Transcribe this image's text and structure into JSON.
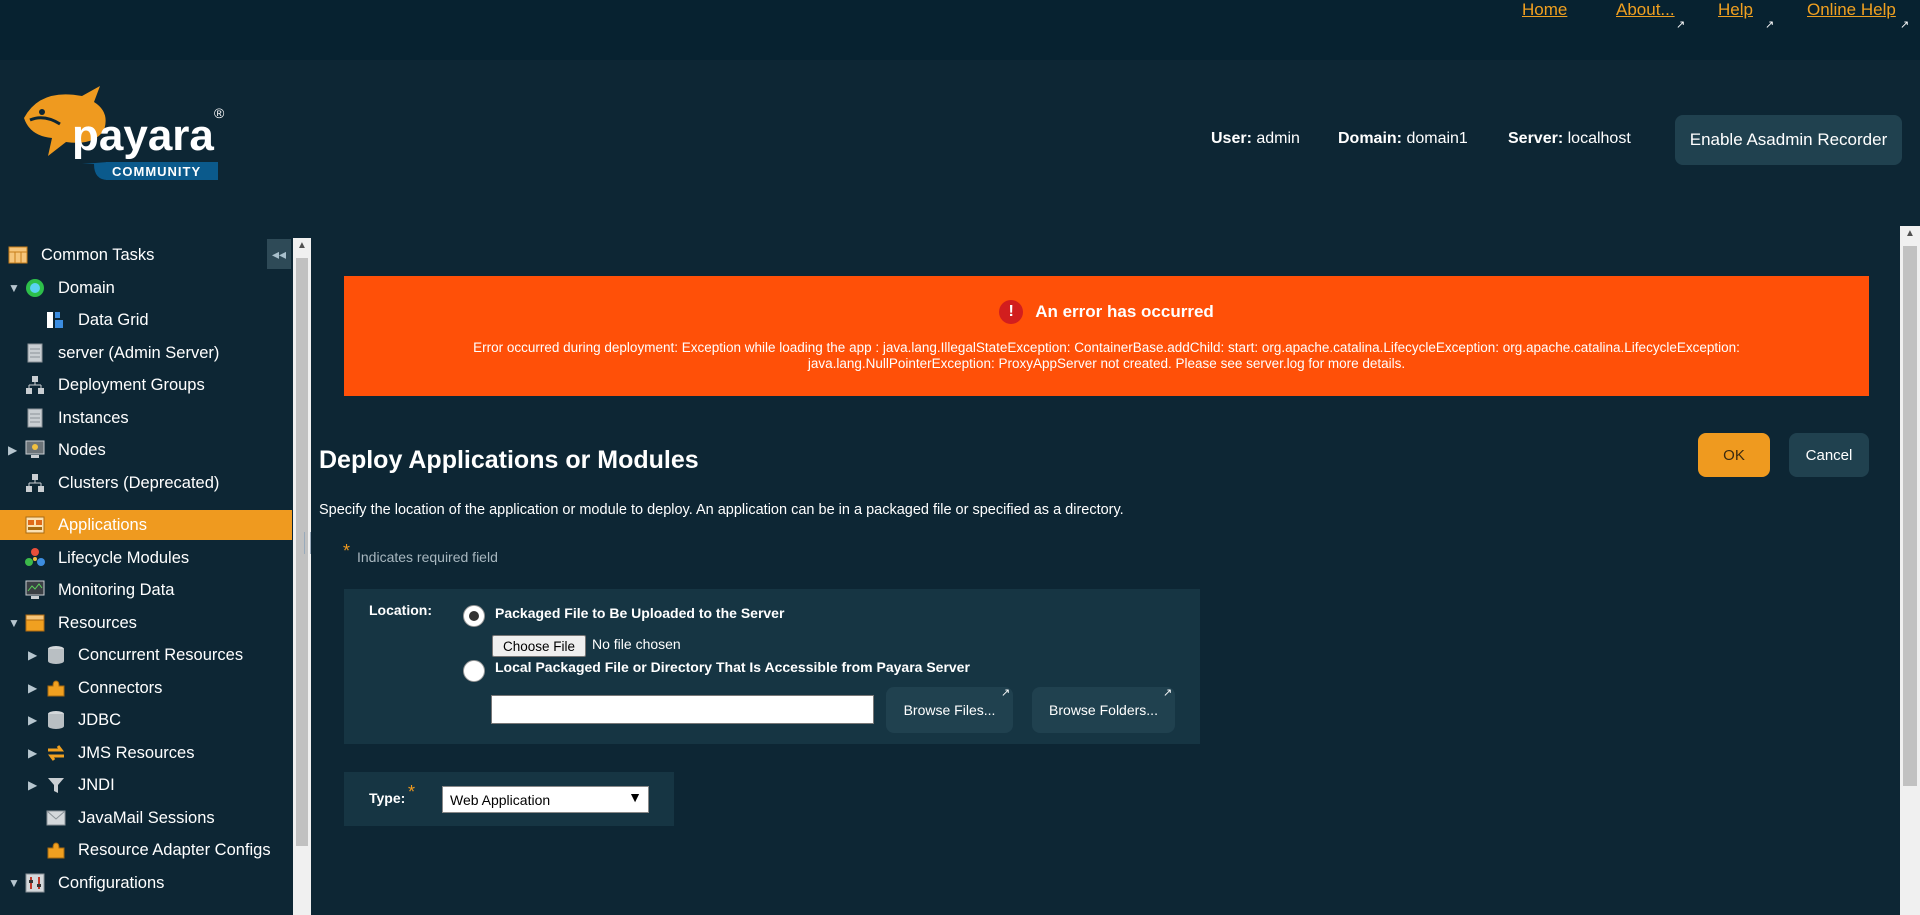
{
  "toplinks": [
    {
      "label": "Home",
      "external": false
    },
    {
      "label": "About...",
      "external": true
    },
    {
      "label": "Help",
      "external": true
    },
    {
      "label": "Online Help",
      "external": true
    }
  ],
  "logo": {
    "brand": "payara",
    "trademark": "®",
    "edition": "COMMUNITY"
  },
  "header": {
    "user_label": "User:",
    "user_value": "admin",
    "domain_label": "Domain:",
    "domain_value": "domain1",
    "server_label": "Server:",
    "server_value": "localhost",
    "recorder_button": "Enable Asadmin Recorder"
  },
  "sidebar": {
    "collapse_icon": "double-chevron-left-icon",
    "items": [
      {
        "label": "Common Tasks",
        "icon": "tasks-icon",
        "toggle": "",
        "selected": false
      },
      {
        "label": "Domain",
        "icon": "globe-icon",
        "toggle": "▼",
        "selected": false
      },
      {
        "label": "Data Grid",
        "icon": "grid-icon",
        "toggle": "",
        "selected": false
      },
      {
        "label": "server (Admin Server)",
        "icon": "server-icon",
        "toggle": "",
        "selected": false
      },
      {
        "label": "Deployment Groups",
        "icon": "group-icon",
        "toggle": "",
        "selected": false
      },
      {
        "label": "Instances",
        "icon": "server-icon",
        "toggle": "",
        "selected": false
      },
      {
        "label": "Nodes",
        "icon": "node-icon",
        "toggle": "▶",
        "selected": false
      },
      {
        "label": "Clusters (Deprecated)",
        "icon": "group-icon",
        "toggle": "",
        "selected": false
      },
      {
        "label": "Applications",
        "icon": "applications-icon",
        "toggle": "",
        "selected": true
      },
      {
        "label": "Lifecycle Modules",
        "icon": "lifecycle-icon",
        "toggle": "",
        "selected": false
      },
      {
        "label": "Monitoring Data",
        "icon": "monitor-icon",
        "toggle": "",
        "selected": false
      },
      {
        "label": "Resources",
        "icon": "box-icon",
        "toggle": "▼",
        "selected": false
      },
      {
        "label": "Concurrent Resources",
        "icon": "database-icon",
        "toggle": "▶",
        "selected": false
      },
      {
        "label": "Connectors",
        "icon": "puzzle-icon",
        "toggle": "▶",
        "selected": false
      },
      {
        "label": "JDBC",
        "icon": "database-icon",
        "toggle": "▶",
        "selected": false
      },
      {
        "label": "JMS Resources",
        "icon": "exchange-icon",
        "toggle": "▶",
        "selected": false
      },
      {
        "label": "JNDI",
        "icon": "filter-icon",
        "toggle": "▶",
        "selected": false
      },
      {
        "label": "JavaMail Sessions",
        "icon": "mail-icon",
        "toggle": "",
        "selected": false
      },
      {
        "label": "Resource Adapter Configs",
        "icon": "puzzle-icon",
        "toggle": "",
        "selected": false
      },
      {
        "label": "Configurations",
        "icon": "config-icon",
        "toggle": "▼",
        "selected": false
      }
    ]
  },
  "error": {
    "title": "An error has occurred",
    "message": "Error occurred during deployment: Exception while loading the app : java.lang.IllegalStateException: ContainerBase.addChild: start: org.apache.catalina.LifecycleException: org.apache.catalina.LifecycleException: java.lang.NullPointerException: ProxyAppServer not created. Please see server.log for more details."
  },
  "main": {
    "title": "Deploy Applications or Modules",
    "description": "Specify the location of the application or module to deploy. An application can be in a packaged file or specified as a directory.",
    "required_star": "*",
    "required_note": "Indicates required field",
    "ok_button": "OK",
    "cancel_button": "Cancel",
    "location_label": "Location:",
    "option_upload": "Packaged File to Be Uploaded to the Server",
    "option_local": "Local Packaged File or Directory That Is Accessible from Payara Server",
    "choose_file": "Choose File",
    "no_file": "No file chosen",
    "local_path_value": "",
    "browse_files": "Browse Files...",
    "browse_folders": "Browse Folders...",
    "type_label": "Type:",
    "type_value": "Web Application"
  },
  "colors": {
    "accent": "#ef9a1f",
    "error": "#ff5008",
    "background": "#0d2634",
    "panel": "#163543"
  }
}
